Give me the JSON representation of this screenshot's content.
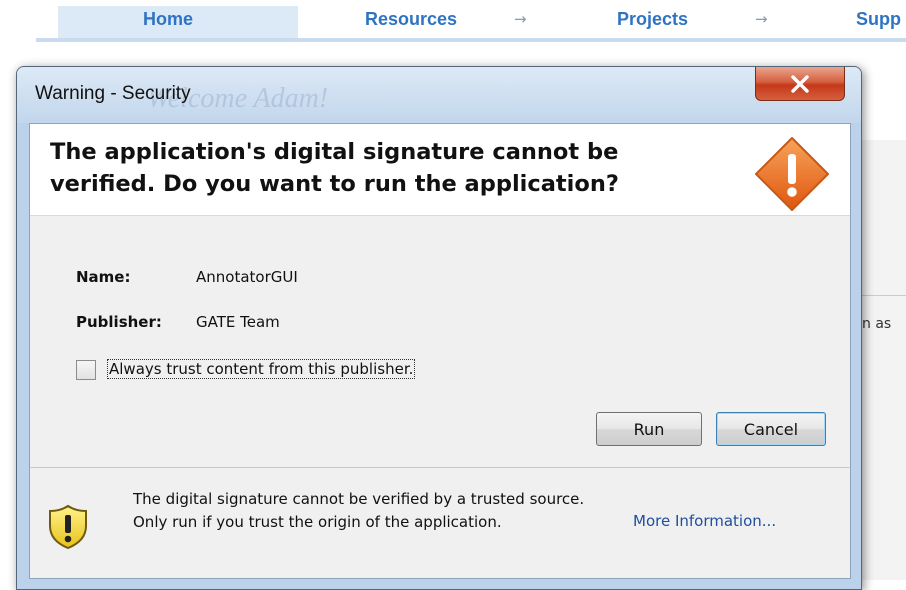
{
  "background": {
    "nav": {
      "home": "Home",
      "resources": "Resources",
      "projects": "Projects",
      "support": "Supp",
      "arrow": "→"
    },
    "ghost_title": "Welcome Adam!",
    "side_text": "n as"
  },
  "dialog": {
    "title": "Warning - Security",
    "close_glyph": "X",
    "heading": "The application's digital signature cannot be verified.  Do you want to run the application?",
    "fields": {
      "name_label": "Name:",
      "name_value": "AnnotatorGUI",
      "publisher_label": "Publisher:",
      "publisher_value": "GATE Team"
    },
    "checkbox": {
      "label": "Always trust content from this publisher.",
      "checked": false
    },
    "buttons": {
      "run": "Run",
      "cancel": "Cancel"
    },
    "footer": {
      "message": "The digital signature cannot be verified by a trusted source.  Only run if you trust the origin of the application.",
      "link": "More Information..."
    },
    "icons": {
      "heading_icon": "warning-diamond-icon",
      "footer_icon": "warning-shield-icon"
    },
    "colors": {
      "close_button": "#c4381a",
      "warning_orange": "#ec6f1a",
      "shield_yellow": "#f5dc3a",
      "link": "#1e4e9e"
    }
  }
}
